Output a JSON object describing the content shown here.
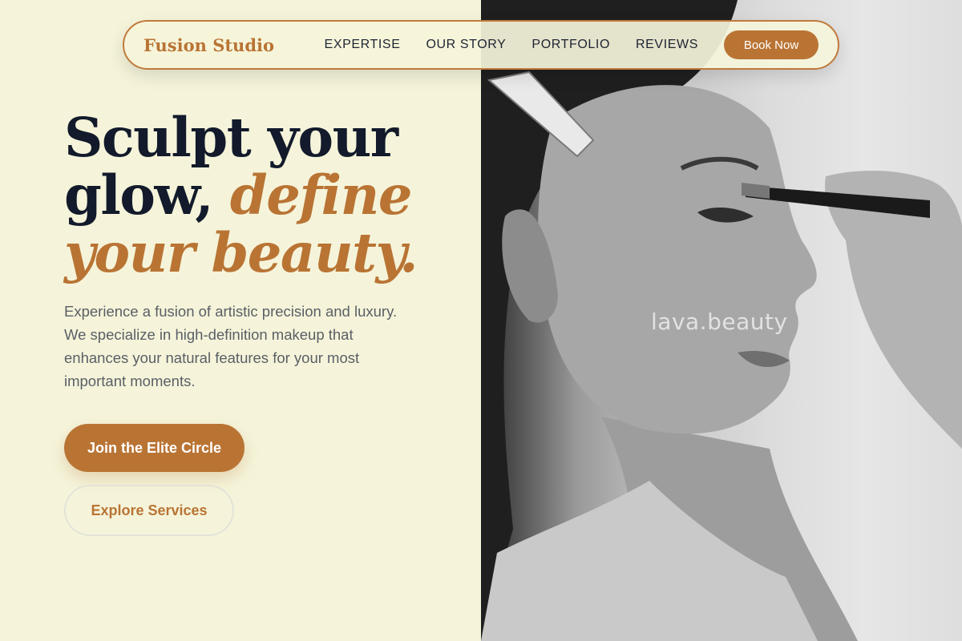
{
  "brand": {
    "name": "Fusion Studio"
  },
  "nav": {
    "links": [
      "EXPERTISE",
      "OUR STORY",
      "PORTFOLIO",
      "REVIEWS"
    ],
    "cta": "Book Now"
  },
  "hero": {
    "headline_line1": "Sculpt your",
    "headline_line2_plain": "glow, ",
    "headline_line2_accent": "define",
    "headline_line3_accent": "your beauty.",
    "intro": "Experience a fusion of artistic precision and luxury. We specialize in high-definition makeup that enhances your natural features for your most important moments.",
    "primary_cta": "Join the Elite Circle",
    "secondary_cta": "Explore Services"
  },
  "image": {
    "watermark": "lava.beauty"
  },
  "colors": {
    "accent": "#b97434",
    "background": "#f5f4da",
    "heading": "#121a2b"
  }
}
